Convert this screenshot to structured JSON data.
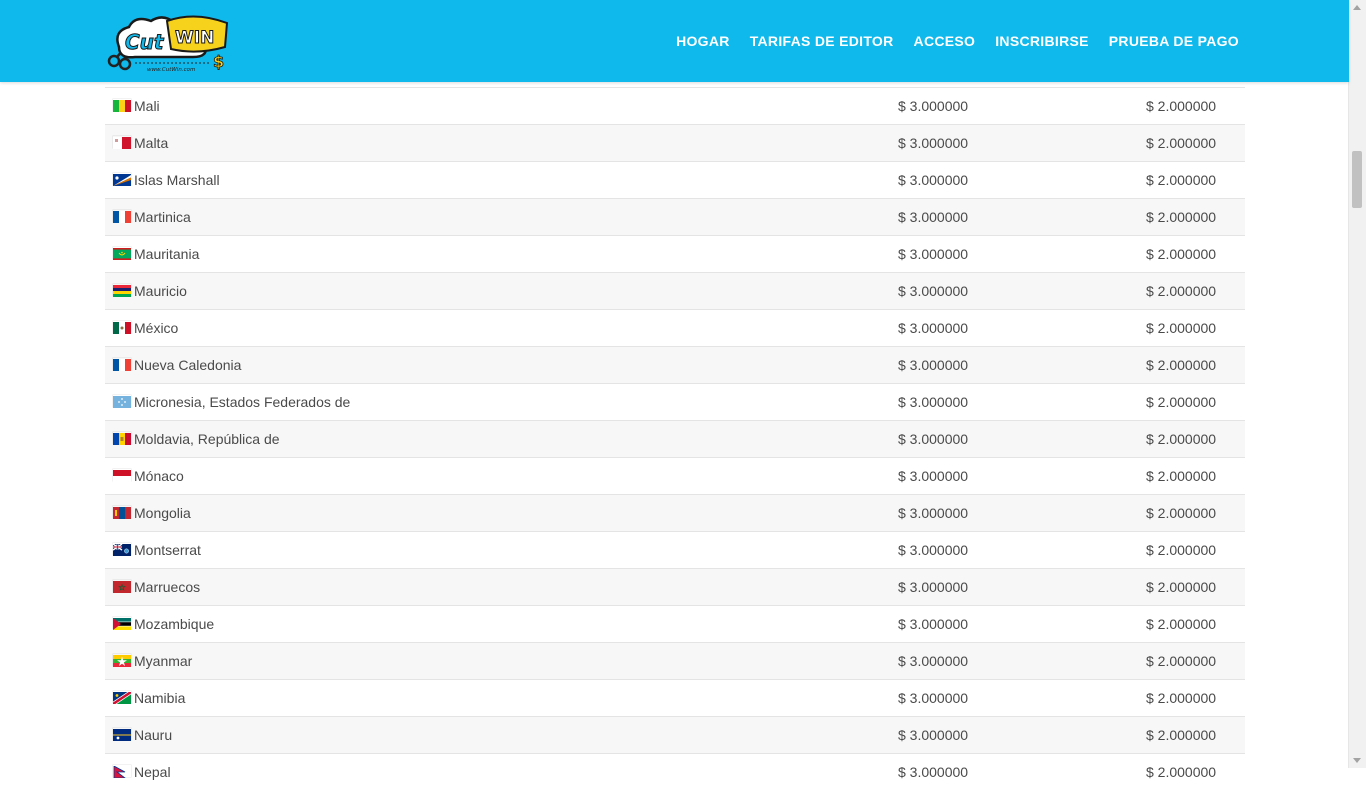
{
  "header": {
    "logo_text": "CutWIN",
    "logo_url_text": "www.CutWin.com",
    "bg_color": "#0fb9ec",
    "nav": [
      {
        "label": "HOGAR"
      },
      {
        "label": "TARIFAS DE EDITOR"
      },
      {
        "label": "ACCESO"
      },
      {
        "label": "INSCRIBIRSE"
      },
      {
        "label": "PRUEBA DE PAGO"
      }
    ]
  },
  "rates": {
    "rows": [
      {
        "flag": "mali-flag",
        "country": "Mali",
        "rate1": "$ 3.000000",
        "rate2": "$ 2.000000"
      },
      {
        "flag": "malta-flag",
        "country": "Malta",
        "rate1": "$ 3.000000",
        "rate2": "$ 2.000000"
      },
      {
        "flag": "marshall-islands-flag",
        "country": "Islas Marshall",
        "rate1": "$ 3.000000",
        "rate2": "$ 2.000000"
      },
      {
        "flag": "martinique-flag",
        "country": "Martinica",
        "rate1": "$ 3.000000",
        "rate2": "$ 2.000000"
      },
      {
        "flag": "mauritania-flag",
        "country": "Mauritania",
        "rate1": "$ 3.000000",
        "rate2": "$ 2.000000"
      },
      {
        "flag": "mauritius-flag",
        "country": "Mauricio",
        "rate1": "$ 3.000000",
        "rate2": "$ 2.000000"
      },
      {
        "flag": "mexico-flag",
        "country": "México",
        "rate1": "$ 3.000000",
        "rate2": "$ 2.000000"
      },
      {
        "flag": "new-caledonia-flag",
        "country": "Nueva Caledonia",
        "rate1": "$ 3.000000",
        "rate2": "$ 2.000000"
      },
      {
        "flag": "micronesia-flag",
        "country": "Micronesia, Estados Federados de",
        "rate1": "$ 3.000000",
        "rate2": "$ 2.000000"
      },
      {
        "flag": "moldova-flag",
        "country": "Moldavia, República de",
        "rate1": "$ 3.000000",
        "rate2": "$ 2.000000"
      },
      {
        "flag": "monaco-flag",
        "country": "Mónaco",
        "rate1": "$ 3.000000",
        "rate2": "$ 2.000000"
      },
      {
        "flag": "mongolia-flag",
        "country": "Mongolia",
        "rate1": "$ 3.000000",
        "rate2": "$ 2.000000"
      },
      {
        "flag": "montserrat-flag",
        "country": "Montserrat",
        "rate1": "$ 3.000000",
        "rate2": "$ 2.000000"
      },
      {
        "flag": "morocco-flag",
        "country": "Marruecos",
        "rate1": "$ 3.000000",
        "rate2": "$ 2.000000"
      },
      {
        "flag": "mozambique-flag",
        "country": "Mozambique",
        "rate1": "$ 3.000000",
        "rate2": "$ 2.000000"
      },
      {
        "flag": "myanmar-flag",
        "country": "Myanmar",
        "rate1": "$ 3.000000",
        "rate2": "$ 2.000000"
      },
      {
        "flag": "namibia-flag",
        "country": "Namibia",
        "rate1": "$ 3.000000",
        "rate2": "$ 2.000000"
      },
      {
        "flag": "nauru-flag",
        "country": "Nauru",
        "rate1": "$ 3.000000",
        "rate2": "$ 2.000000"
      },
      {
        "flag": "nepal-flag",
        "country": "Nepal",
        "rate1": "$ 3.000000",
        "rate2": "$ 2.000000"
      }
    ]
  }
}
